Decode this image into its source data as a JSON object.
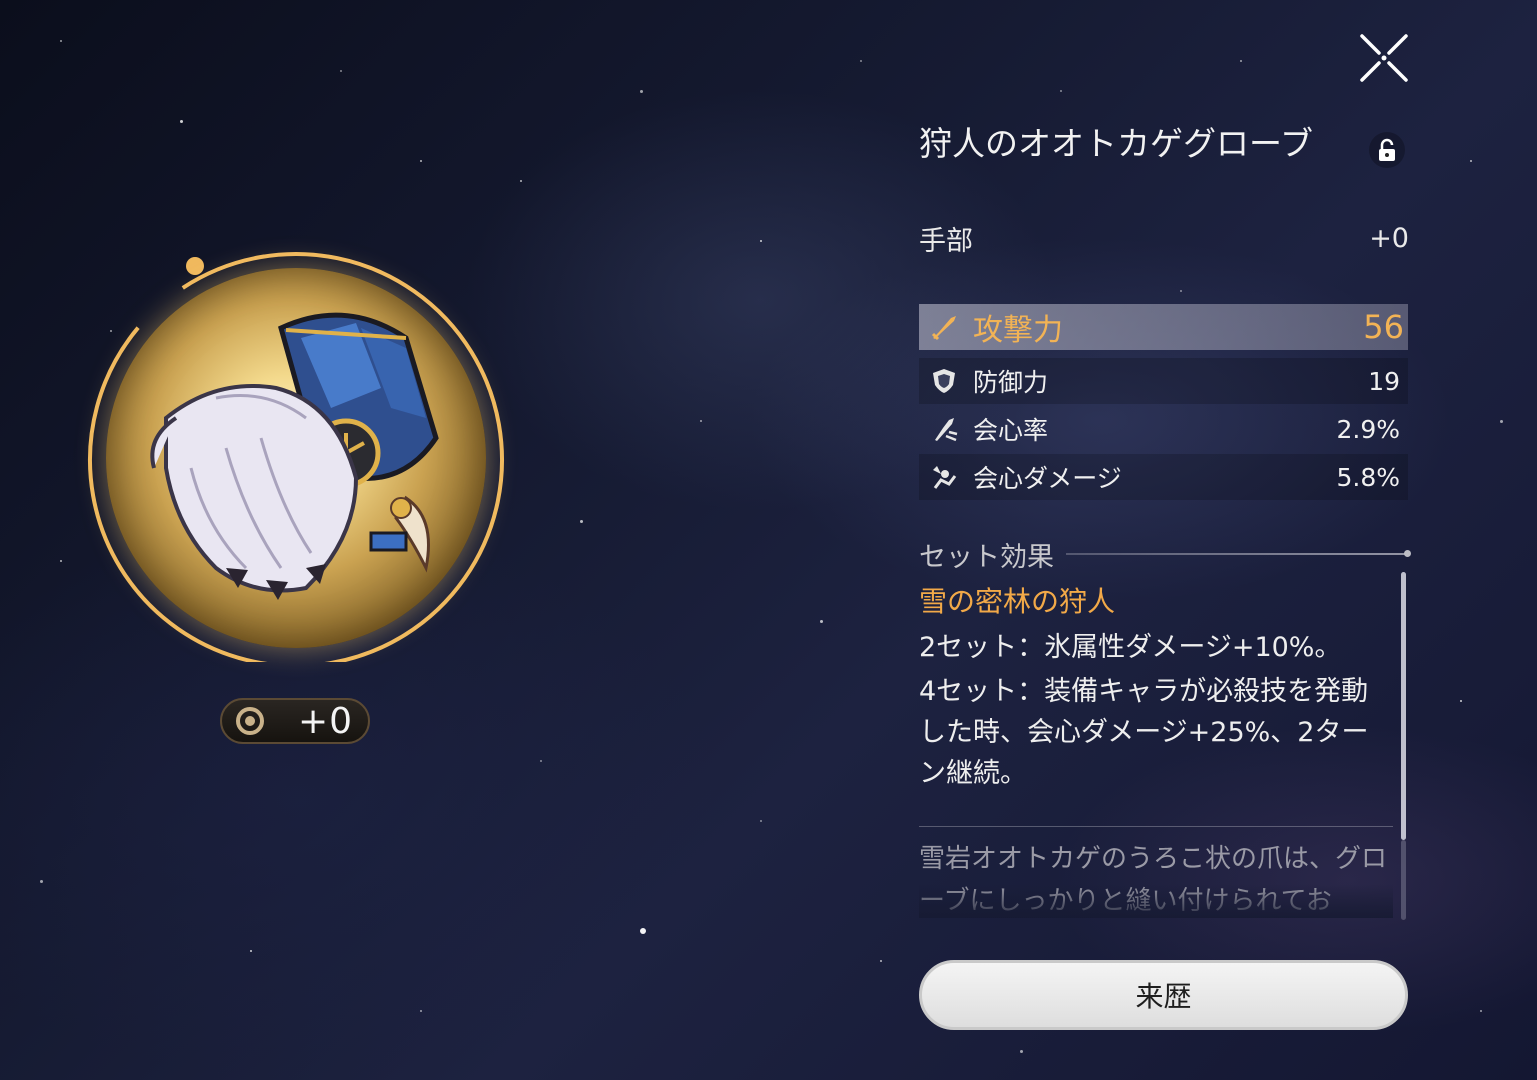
{
  "relic": {
    "name": "狩人のオオトカゲグローブ",
    "slot": "手部",
    "level": "+0",
    "level_badge": "+0"
  },
  "main_stat": {
    "name": "攻撃力",
    "value": "56",
    "icon": "attack-icon"
  },
  "sub_stats": [
    {
      "name": "防御力",
      "value": "19",
      "icon": "defense-icon"
    },
    {
      "name": "会心率",
      "value": "2.9%",
      "icon": "crit-rate-icon"
    },
    {
      "name": "会心ダメージ",
      "value": "5.8%",
      "icon": "crit-damage-icon"
    }
  ],
  "set": {
    "header": "セット効果",
    "name": "雪の密林の狩人",
    "effect_2": "2セット：氷属性ダメージ+10%。",
    "effect_4": "4セット：装備キャラが必殺技を発動した時、会心ダメージ+25%、2ターン継続。"
  },
  "lore": "雪岩オオトカゲのうろこ状の爪は、グローブにしっかりと縫い付けられてお",
  "buttons": {
    "history": "来歴"
  },
  "colors": {
    "accent_gold": "#f2a948",
    "main_stat_value": "#f2b355",
    "ring": "#f0b95e"
  }
}
